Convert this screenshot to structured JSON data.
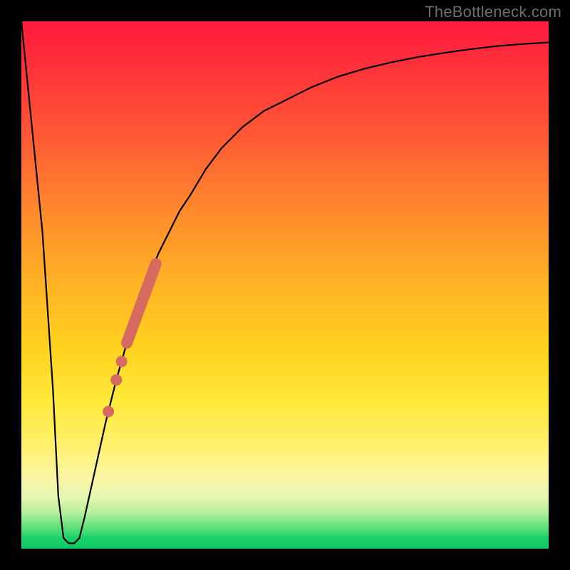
{
  "watermark": {
    "text": "TheBottleneck.com"
  },
  "colors": {
    "frame": "#000000",
    "curve": "#000000",
    "marker": "#d66a5f",
    "gradient_top": "#ff1a3d",
    "gradient_bottom": "#10c864"
  },
  "chart_data": {
    "type": "line",
    "title": "",
    "xlabel": "",
    "ylabel": "",
    "xlim": [
      0,
      100
    ],
    "ylim": [
      0,
      100
    ],
    "grid": false,
    "legend": false,
    "background": "vertical-heatmap-gradient",
    "series": [
      {
        "name": "bottleneck-curve",
        "x": [
          0,
          2,
          4,
          6,
          7,
          8,
          9,
          10,
          11,
          12,
          14,
          16,
          18,
          20,
          22,
          24,
          26,
          28,
          30,
          32,
          35,
          38,
          42,
          46,
          50,
          55,
          60,
          65,
          70,
          75,
          80,
          85,
          90,
          95,
          100
        ],
        "y": [
          100,
          80,
          60,
          30,
          10,
          2,
          1,
          1,
          2,
          6,
          15,
          24,
          32,
          39,
          45,
          51,
          56,
          60,
          64,
          67,
          72,
          76,
          80,
          83,
          85,
          87.5,
          89.5,
          91,
          92.2,
          93.2,
          94,
          94.7,
          95.3,
          95.7,
          96
        ]
      }
    ],
    "markers": [
      {
        "name": "highlight-segment",
        "type": "segment",
        "x": [
          20,
          25.5
        ],
        "y": [
          39,
          54
        ]
      },
      {
        "name": "highlight-dot-1",
        "type": "dot",
        "x": 19,
        "y": 35.5
      },
      {
        "name": "highlight-dot-2",
        "type": "dot",
        "x": 18,
        "y": 32
      },
      {
        "name": "highlight-dot-3",
        "type": "dot",
        "x": 16.5,
        "y": 26
      }
    ],
    "notes": "x and y are in percent of the plotting area; y=0 is bottom (green), y=100 is top (red). The curve dips to a narrow flat minimum near x≈8–10 then rises asymptotically toward y≈96."
  }
}
